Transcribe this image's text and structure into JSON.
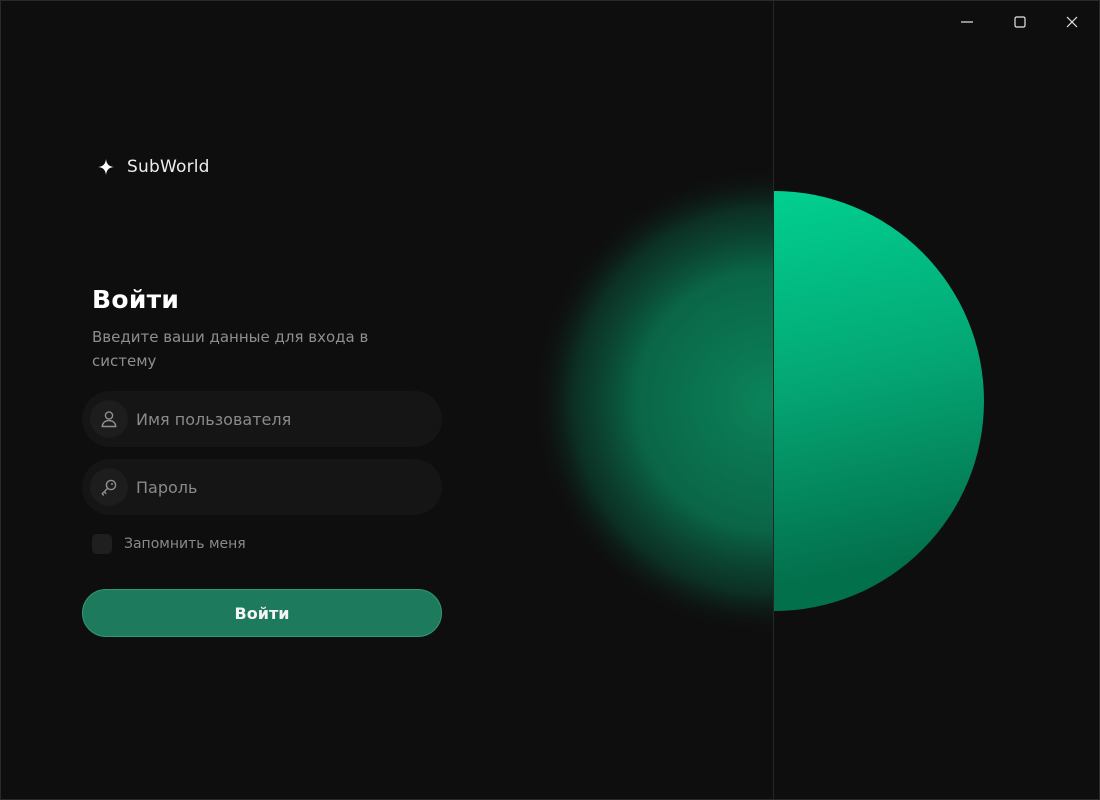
{
  "window_controls": {
    "minimize": "minimize-icon",
    "maximize": "maximize-icon",
    "close": "close-icon"
  },
  "brand": {
    "name": "SubWorld",
    "icon": "sparkle-icon"
  },
  "login": {
    "title": "Войти",
    "subtitle": "Введите ваши данные для входа в систему",
    "username": {
      "placeholder": "Имя пользователя",
      "value": "",
      "icon": "user-icon"
    },
    "password": {
      "placeholder": "Пароль",
      "value": "",
      "icon": "key-icon"
    },
    "remember_label": "Запомнить меня",
    "remember_checked": false,
    "submit_label": "Войти"
  },
  "colors": {
    "background": "#0e0e0e",
    "accent": "#1e7a5c",
    "accent_border": "#2f9a74",
    "sphere_light": "#00d896",
    "sphere_dark": "#03704c",
    "field_bg": "#151515",
    "muted_text": "#8a8a8a"
  }
}
